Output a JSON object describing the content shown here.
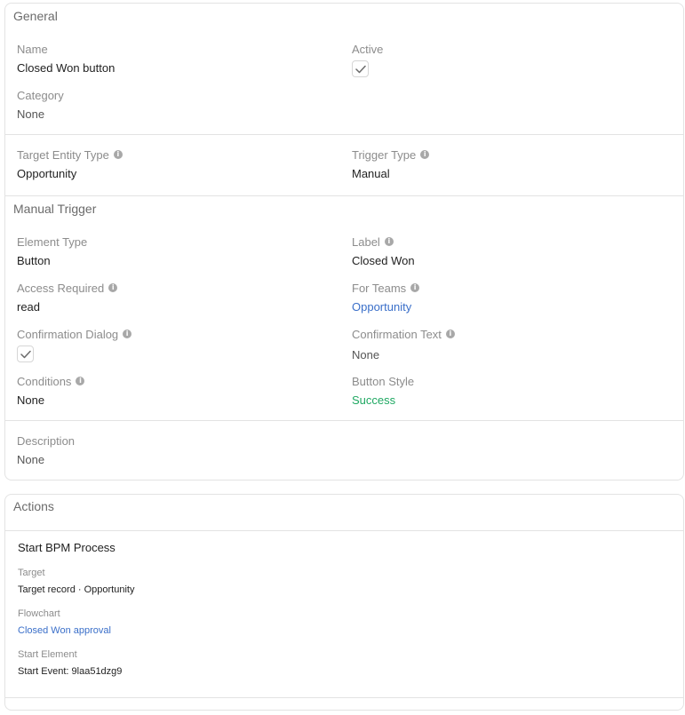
{
  "general": {
    "heading": "General",
    "name": {
      "label": "Name",
      "value": "Closed Won button"
    },
    "active": {
      "label": "Active",
      "checked": true
    },
    "category": {
      "label": "Category",
      "value": "None"
    },
    "target_entity_type": {
      "label": "Target Entity Type",
      "value": "Opportunity"
    },
    "trigger_type": {
      "label": "Trigger Type",
      "value": "Manual"
    }
  },
  "manual_trigger": {
    "heading": "Manual Trigger",
    "element_type": {
      "label": "Element Type",
      "value": "Button"
    },
    "label": {
      "label": "Label",
      "value": "Closed Won"
    },
    "access_required": {
      "label": "Access Required",
      "value": "read"
    },
    "for_teams": {
      "label": "For Teams",
      "value": "Opportunity"
    },
    "confirmation_dialog": {
      "label": "Confirmation Dialog",
      "checked": true
    },
    "confirmation_text": {
      "label": "Confirmation Text",
      "value": "None"
    },
    "conditions": {
      "label": "Conditions",
      "value": "None"
    },
    "button_style": {
      "label": "Button Style",
      "value": "Success"
    },
    "description": {
      "label": "Description",
      "value": "None"
    }
  },
  "actions": {
    "heading": "Actions",
    "items": [
      {
        "title": "Start BPM Process",
        "target": {
          "label": "Target",
          "value": "Target record · Opportunity"
        },
        "flowchart": {
          "label": "Flowchart",
          "value": "Closed Won approval"
        },
        "start_element": {
          "label": "Start Element",
          "value": "Start Event: 9laa51dzg9"
        }
      }
    ]
  },
  "colors": {
    "link": "#3a6fc9",
    "success": "#1fa862",
    "border": "#e3e3e3",
    "label": "#8c8c8c"
  },
  "icons": {
    "info": "info-icon",
    "check": "check-icon"
  }
}
